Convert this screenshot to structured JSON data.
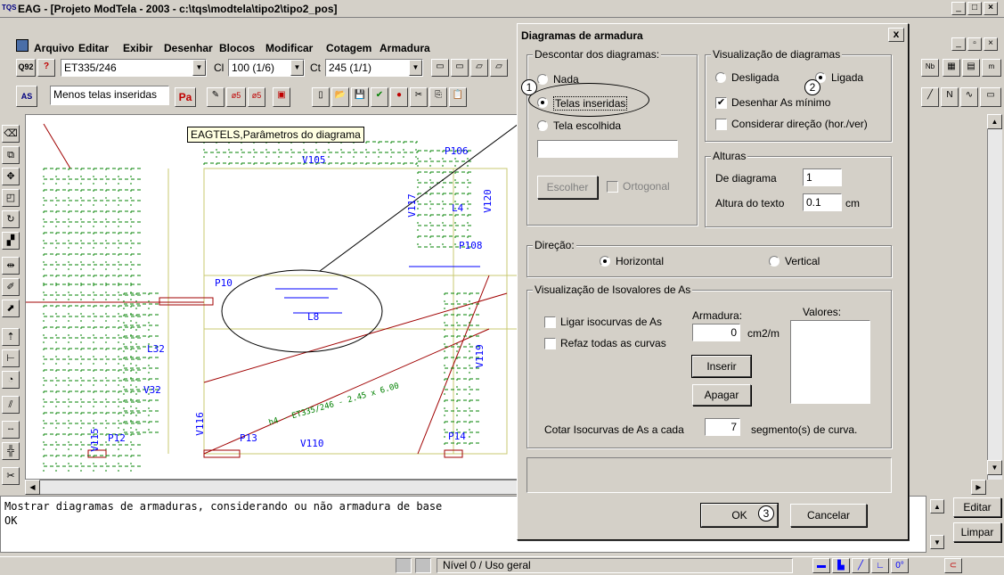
{
  "window": {
    "title": "EAG - [Projeto ModTela - 2003 - c:\\tqs\\modtela\\tipo2\\tipo2_pos]",
    "app_icon": "TQS"
  },
  "menu": [
    "Arquivo",
    "Editar",
    "Exibir",
    "Desenhar",
    "Blocos",
    "Modificar",
    "Cotagem",
    "Armadura"
  ],
  "toolbar1": {
    "q92": "Q92",
    "tela_combo": "ET335/246",
    "cl_label": "Cl",
    "cl_value": "100 (1/6)",
    "ct_label": "Ct",
    "ct_value": "245 (1/1)"
  },
  "toolbar2": {
    "mode_combo": "Menos telas inseridas",
    "pa_label": "Pa",
    "tooltip": "EAGTELS,Parâmetros do diagrama"
  },
  "command": {
    "line1": "Mostrar diagramas de armaduras, considerando ou não armadura de base",
    "line2": "OK",
    "editar": "Editar",
    "limpar": "Limpar"
  },
  "status": {
    "nivel": "Nível 0 / Uso geral"
  },
  "cad": {
    "labels": [
      "V105",
      "P106",
      "V117",
      "L4",
      "V120",
      "P108",
      "P10",
      "L8",
      "V32",
      "L32",
      "V116",
      "V119",
      "P12",
      "P13",
      "V110",
      "P14",
      "V115"
    ],
    "annotation": "h4 - ET335/246 - 2.45 x 6.00"
  },
  "dialog": {
    "title": "Diagramas de armadura",
    "close": "x",
    "descontar": {
      "label": "Descontar dos diagramas:",
      "options": [
        "Nada",
        "Telas inseridas",
        "Tela escolhida"
      ],
      "selected": "Telas inseridas",
      "escolher": "Escolher",
      "ortogonal": "Ortogonal"
    },
    "visualizacao": {
      "label": "Visualização de diagramas",
      "desligada": "Desligada",
      "ligada": "Ligada",
      "selected": "Ligada",
      "desenhar_as_minimo": "Desenhar As mínimo",
      "desenhar_checked": true,
      "considerar_direcao": "Considerar direção (hor./ver)",
      "considerar_checked": false
    },
    "alturas": {
      "label": "Alturas",
      "de_diagrama": "De diagrama",
      "de_diagrama_value": "1",
      "altura_texto": "Altura do texto",
      "altura_texto_value": "0.1",
      "unit": "cm"
    },
    "direcao": {
      "label": "Direção:",
      "horizontal": "Horizontal",
      "vertical": "Vertical",
      "selected": "Horizontal"
    },
    "isovalores": {
      "label": "Visualização de Isovalores de As",
      "ligar": "Ligar isocurvas de As",
      "refaz": "Refaz todas as curvas",
      "armadura": "Armadura:",
      "armadura_value": "0",
      "unit": "cm2/m",
      "valores": "Valores:",
      "inserir": "Inserir",
      "apagar": "Apagar",
      "cotar_label": "Cotar Isocurvas de As a cada",
      "cotar_value": "7",
      "segmentos": "segmento(s) de curva."
    },
    "ok": "OK",
    "cancelar": "Cancelar"
  },
  "callouts": [
    "1",
    "2",
    "3"
  ],
  "colors": {
    "selection": "#000080",
    "cad_blue": "#0000ff",
    "cad_green": "#008000",
    "cad_red": "#a00000",
    "cad_yellow": "#c8c870"
  }
}
